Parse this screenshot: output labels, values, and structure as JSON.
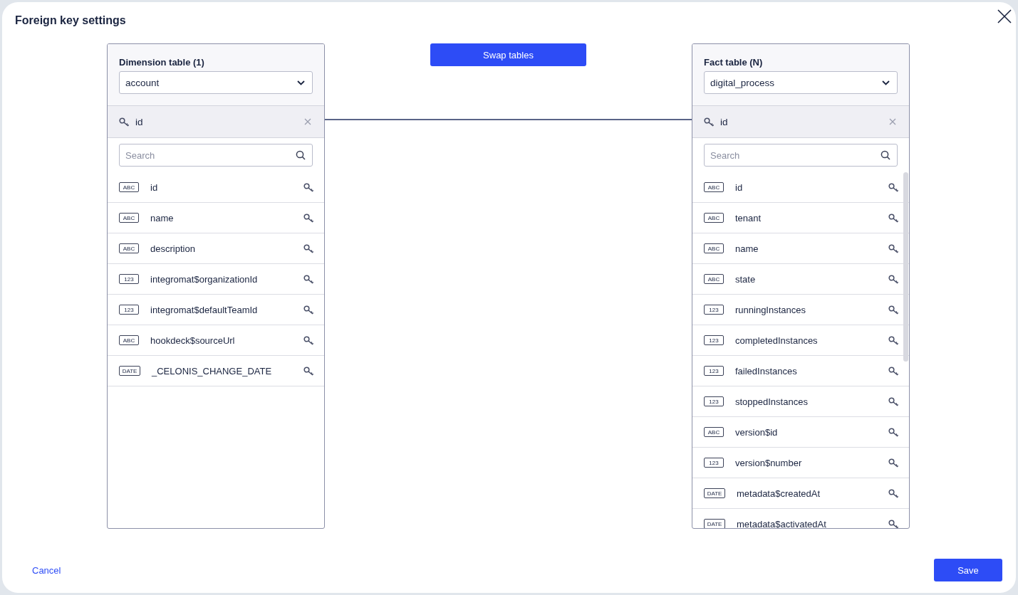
{
  "dialog": {
    "title": "Foreign key settings"
  },
  "swap_button": "Swap tables",
  "panels": [
    {
      "label": "Dimension table (1)",
      "table": "account",
      "key": "id",
      "search": {
        "placeholder": "Search"
      },
      "columns": [
        {
          "type": "ABC",
          "name": "id"
        },
        {
          "type": "ABC",
          "name": "name"
        },
        {
          "type": "ABC",
          "name": "description"
        },
        {
          "type": "123",
          "name": "integromat$organizationId"
        },
        {
          "type": "123",
          "name": "integromat$defaultTeamId"
        },
        {
          "type": "ABC",
          "name": "hookdeck$sourceUrl"
        },
        {
          "type": "DATE",
          "name": "_CELONIS_CHANGE_DATE"
        }
      ]
    },
    {
      "label": "Fact table (N)",
      "table": "digital_process",
      "key": "id",
      "search": {
        "placeholder": "Search"
      },
      "columns": [
        {
          "type": "ABC",
          "name": "id"
        },
        {
          "type": "ABC",
          "name": "tenant"
        },
        {
          "type": "ABC",
          "name": "name"
        },
        {
          "type": "ABC",
          "name": "state"
        },
        {
          "type": "123",
          "name": "runningInstances"
        },
        {
          "type": "123",
          "name": "completedInstances"
        },
        {
          "type": "123",
          "name": "failedInstances"
        },
        {
          "type": "123",
          "name": "stoppedInstances"
        },
        {
          "type": "ABC",
          "name": "version$id"
        },
        {
          "type": "123",
          "name": "version$number"
        },
        {
          "type": "DATE",
          "name": "metadata$createdAt"
        },
        {
          "type": "DATE",
          "name": "metadata$activatedAt"
        }
      ]
    }
  ],
  "footer": {
    "cancel": "Cancel",
    "save": "Save"
  }
}
